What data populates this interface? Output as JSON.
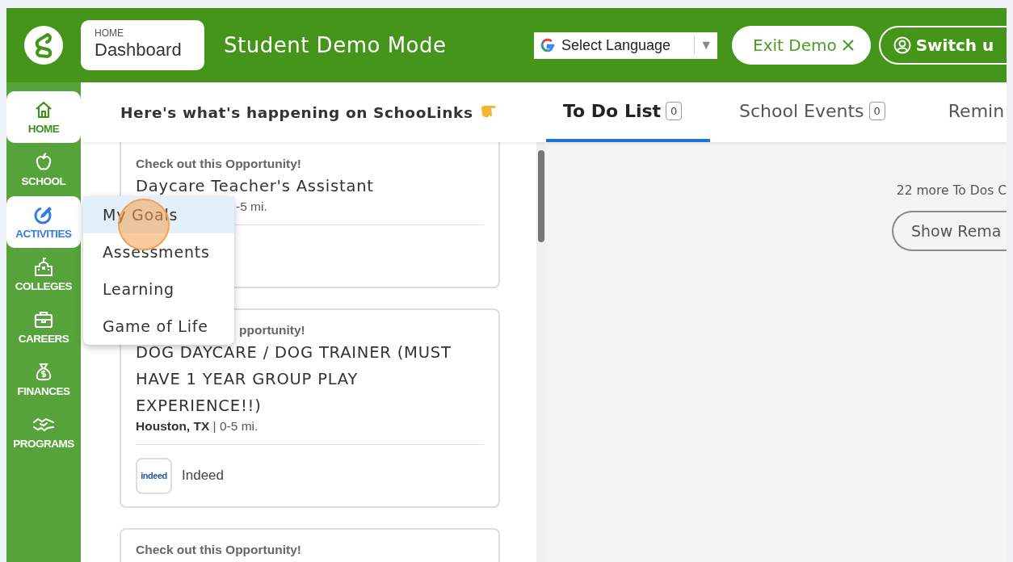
{
  "header": {
    "breadcrumb": {
      "section": "HOME",
      "page": "Dashboard"
    },
    "title": "Student Demo Mode",
    "language_select": {
      "label": "Select Language",
      "arrow": "▼"
    },
    "buttons": [
      {
        "kind": "exit",
        "label": "Exit Demo"
      },
      {
        "kind": "switch",
        "label": "Switch u"
      }
    ]
  },
  "sidebar": {
    "items": [
      {
        "label": "HOME",
        "selected": true,
        "open": false
      },
      {
        "label": "SCHOOL",
        "selected": false,
        "open": false
      },
      {
        "label": "ACTIVITIES",
        "selected": false,
        "open": true
      },
      {
        "label": "COLLEGES",
        "selected": false,
        "open": false
      },
      {
        "label": "CAREERS",
        "selected": false,
        "open": false
      },
      {
        "label": "FINANCES",
        "selected": false,
        "open": false
      },
      {
        "label": "PROGRAMS",
        "selected": false,
        "open": false
      }
    ]
  },
  "activities_menu": {
    "items": [
      {
        "label": "My Goals",
        "selected": true
      },
      {
        "label": "Assessments",
        "selected": false
      },
      {
        "label": "Learning",
        "selected": false
      },
      {
        "label": "Game of Life",
        "selected": false
      }
    ]
  },
  "feed": {
    "heading": "Here's what's happening on SchooLinks",
    "cards": [
      {
        "label": "Check out this Opportunity!",
        "title": "Daycare Teacher's Assistant",
        "location": "-5 mi."
      },
      {
        "label": "pportunity!",
        "title": "DOG DAYCARE / DOG TRAINER (MUST HAVE 1 YEAR GROUP PLAY EXPERIENCE!!)",
        "location": "**Houston, TX** | 0-5 mi.",
        "source_logo": "indeed",
        "source": "Indeed"
      },
      {
        "label": "Check out this Opportunity!"
      }
    ]
  },
  "tabs": [
    {
      "label": "To Do List",
      "count": "0",
      "selected": true
    },
    {
      "label": "School Events",
      "count": "0",
      "selected": false
    },
    {
      "label": "Remin",
      "selected": false
    }
  ],
  "todo": {
    "more_text": "22 more To Dos C",
    "show_button": "Show Rema"
  }
}
